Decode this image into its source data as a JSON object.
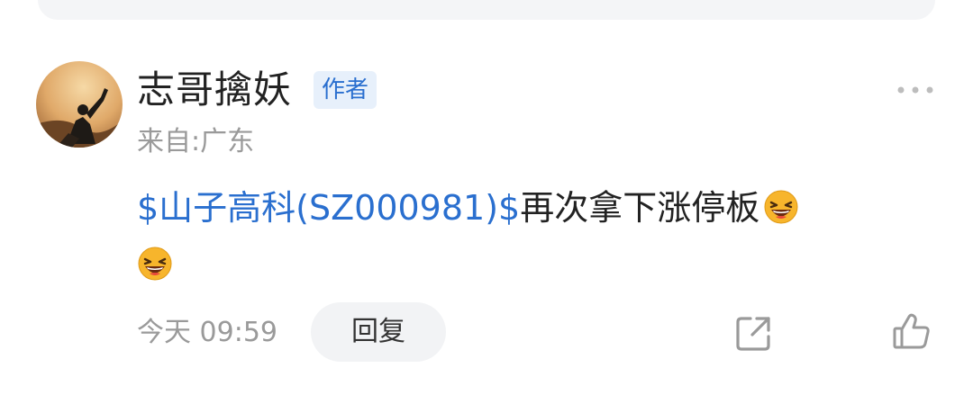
{
  "comment": {
    "author": "志哥擒妖",
    "author_badge": "作者",
    "location": "来自:广东",
    "stock_link": "$山子高科(SZ000981)$",
    "text": "再次拿下涨停板",
    "emoji": "laughing-face-emoji",
    "timestamp": "今天 09:59",
    "reply_label": "回复"
  },
  "colors": {
    "link": "#2a6fcf",
    "muted": "#9a9a9a",
    "badge_bg": "#e7f0fb"
  }
}
